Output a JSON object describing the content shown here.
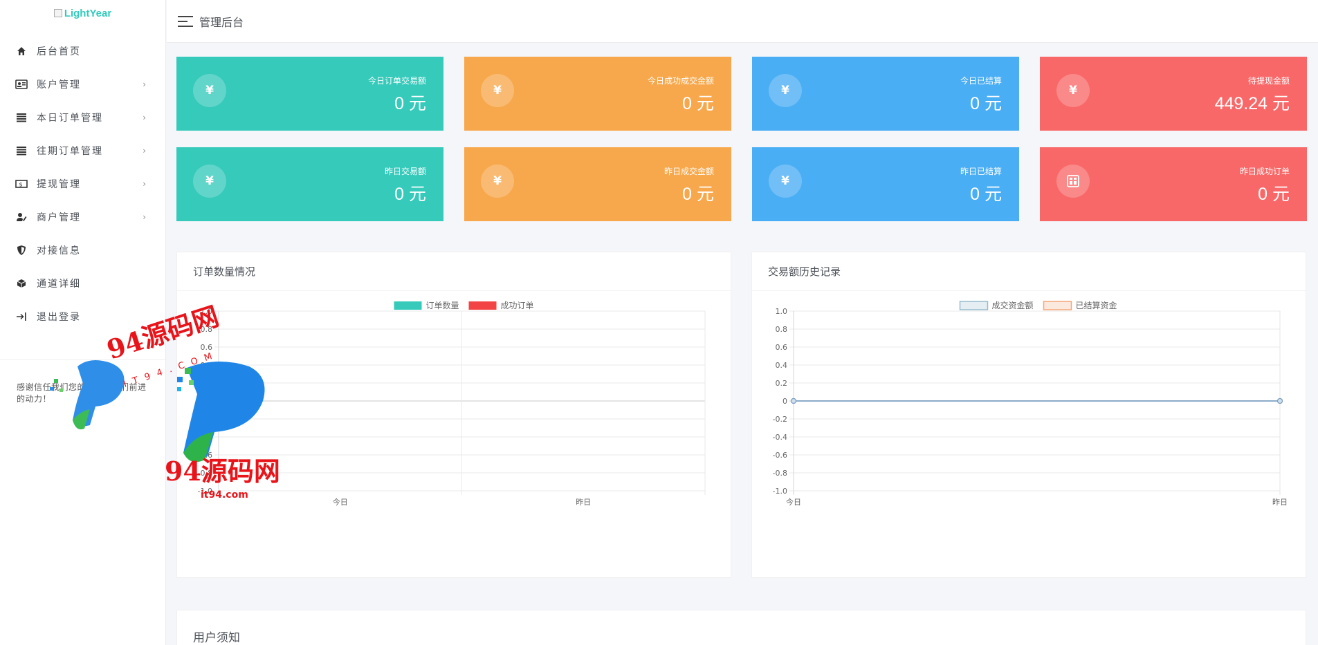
{
  "sidebar": {
    "logo_alt": "LightYear",
    "items": [
      {
        "label": "后台首页",
        "icon": "home-icon",
        "has_children": false
      },
      {
        "label": "账户管理",
        "icon": "id-card-icon",
        "has_children": true
      },
      {
        "label": "本日订单管理",
        "icon": "list-icon",
        "has_children": true
      },
      {
        "label": "往期订单管理",
        "icon": "list-icon",
        "has_children": true
      },
      {
        "label": "提现管理",
        "icon": "cash-icon",
        "has_children": true
      },
      {
        "label": "商户管理",
        "icon": "user-edit-icon",
        "has_children": true
      },
      {
        "label": "对接信息",
        "icon": "shield-icon",
        "has_children": false
      },
      {
        "label": "通道详细",
        "icon": "cube-icon",
        "has_children": false
      },
      {
        "label": "退出登录",
        "icon": "logout-icon",
        "has_children": false
      }
    ],
    "chevron": "›",
    "note": "感谢信任我们您的支持给我们前进的动力！"
  },
  "header": {
    "title": "管理后台"
  },
  "stats": [
    {
      "caption": "今日订单交易额",
      "value": "0 元",
      "icon": "¥",
      "color": "#36cabb"
    },
    {
      "caption": "今日成功成交金额",
      "value": "0 元",
      "icon": "¥",
      "color": "#f8a84c"
    },
    {
      "caption": "今日已结算",
      "value": "0 元",
      "icon": "¥",
      "color": "#4aaef4"
    },
    {
      "caption": "待提现金额",
      "value": "449.24 元",
      "icon": "¥",
      "color": "#f96868"
    },
    {
      "caption": "昨日交易额",
      "value": "0 元",
      "icon": "¥",
      "color": "#36cabb"
    },
    {
      "caption": "昨日成交金额",
      "value": "0 元",
      "icon": "¥",
      "color": "#f8a84c"
    },
    {
      "caption": "昨日已结算",
      "value": "0 元",
      "icon": "¥",
      "color": "#4aaef4"
    },
    {
      "caption": "昨日成功订单",
      "value": "0 元",
      "icon": "table-icon",
      "color": "#f96868"
    }
  ],
  "panels": {
    "orders_title": "订单数量情况",
    "history_title": "交易额历史记录",
    "notice_title": "用户须知"
  },
  "watermark": {
    "name": "94源码网",
    "domain": "it94.com",
    "spaced": "I T 9 4 . C O M"
  },
  "chart_data": [
    {
      "type": "bar",
      "title": "订单数量情况",
      "categories": [
        "今日",
        "昨日"
      ],
      "series": [
        {
          "name": "订单数量",
          "values": [
            0,
            0
          ],
          "color": "#36cabb"
        },
        {
          "name": "成功订单",
          "values": [
            0,
            0
          ],
          "color": "#f24444"
        }
      ],
      "ylim": [
        -1.0,
        1.0
      ],
      "yticks": [
        "1.0",
        "0.8",
        "0.6",
        "0.4",
        "0.2",
        "0",
        "-0.2",
        "-0.4",
        "-0.6",
        "-0.8",
        "-1.0"
      ],
      "grid": true,
      "legend": "top-center"
    },
    {
      "type": "line",
      "title": "交易额历史记录",
      "categories": [
        "今日",
        "昨日"
      ],
      "series": [
        {
          "name": "成交资金额",
          "values": [
            0,
            0
          ],
          "color": "#97bbcd"
        },
        {
          "name": "已结算资金",
          "values": [
            0,
            0
          ],
          "color": "#f5a67a"
        }
      ],
      "ylim": [
        -1.0,
        1.0
      ],
      "yticks": [
        "1.0",
        "0.8",
        "0.6",
        "0.4",
        "0.2",
        "0",
        "-0.2",
        "-0.4",
        "-0.6",
        "-0.8",
        "-1.0"
      ],
      "grid": true,
      "legend": "top-center"
    }
  ]
}
